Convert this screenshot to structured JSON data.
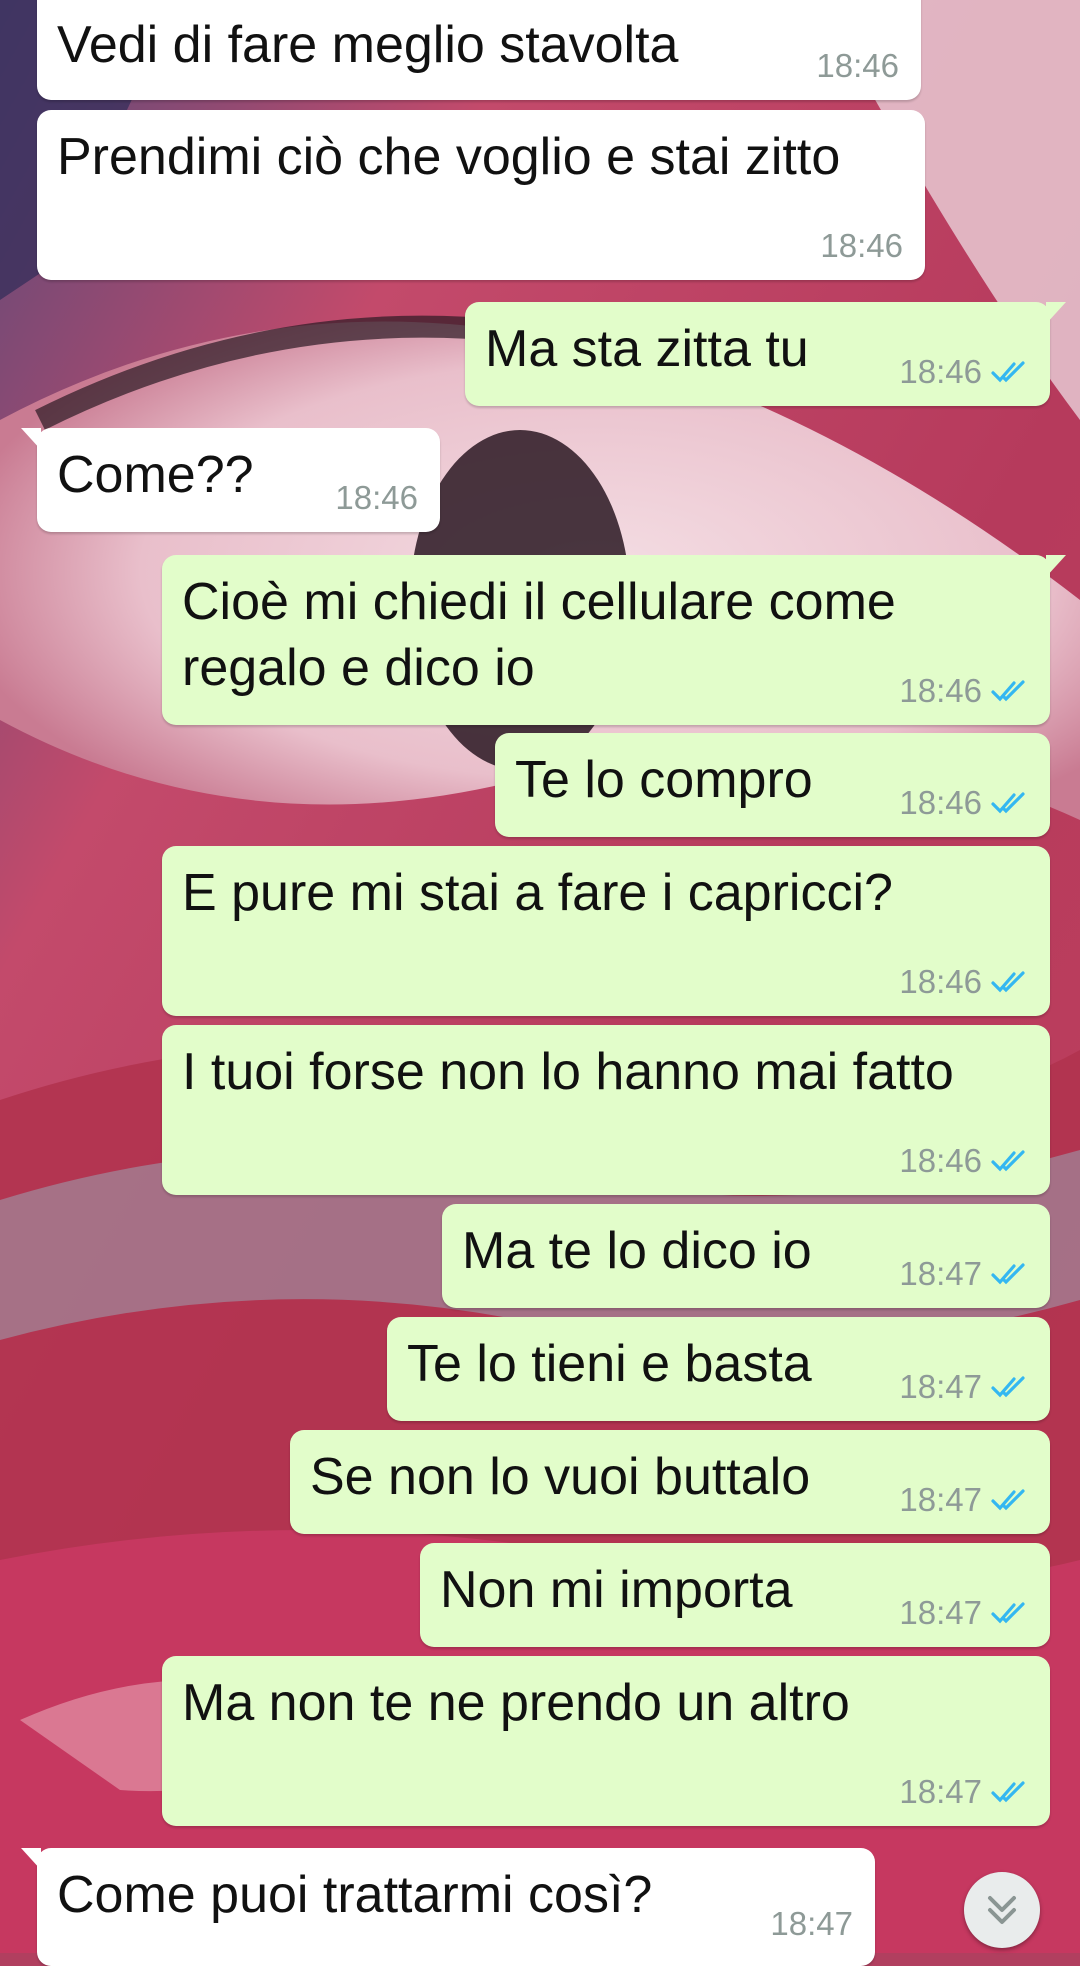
{
  "theme": {
    "incoming_bubble": "#ffffff",
    "outgoing_bubble": "#e2fdca",
    "read_ticks": "#34b7f1",
    "time_text": "#8e9a97"
  },
  "messages": [
    {
      "dir": "in",
      "text": "Vedi di fare meglio stavolta",
      "time": "18:46"
    },
    {
      "dir": "in",
      "text": "Prendimi ciò che voglio e stai zitto",
      "time": "18:46"
    },
    {
      "dir": "out",
      "text": "Ma sta zitta tu",
      "time": "18:46",
      "status": "read-ticks-icon"
    },
    {
      "dir": "in",
      "text": "Come??",
      "time": "18:46"
    },
    {
      "dir": "out",
      "text": "Cioè mi chiedi il cellulare come regalo e dico io",
      "time": "18:46",
      "status": "read-ticks-icon"
    },
    {
      "dir": "out",
      "text": "Te lo compro",
      "time": "18:46",
      "status": "read-ticks-icon"
    },
    {
      "dir": "out",
      "text": "E pure mi stai a fare i capricci?",
      "time": "18:46",
      "status": "read-ticks-icon"
    },
    {
      "dir": "out",
      "text": "I tuoi forse non lo hanno mai fatto",
      "time": "18:46",
      "status": "read-ticks-icon"
    },
    {
      "dir": "out",
      "text": "Ma te lo dico io",
      "time": "18:47",
      "status": "read-ticks-icon"
    },
    {
      "dir": "out",
      "text": "Te lo tieni e basta",
      "time": "18:47",
      "status": "read-ticks-icon"
    },
    {
      "dir": "out",
      "text": "Se non lo vuoi buttalo",
      "time": "18:47",
      "status": "read-ticks-icon"
    },
    {
      "dir": "out",
      "text": "Non mi importa",
      "time": "18:47",
      "status": "read-ticks-icon"
    },
    {
      "dir": "out",
      "text": "Ma non te ne prendo un altro",
      "time": "18:47",
      "status": "read-ticks-icon"
    },
    {
      "dir": "in",
      "text": "Come puoi trattarmi così?",
      "time": "18:47"
    }
  ],
  "scroll_button": {
    "icon": "double-chevron-down-icon"
  }
}
